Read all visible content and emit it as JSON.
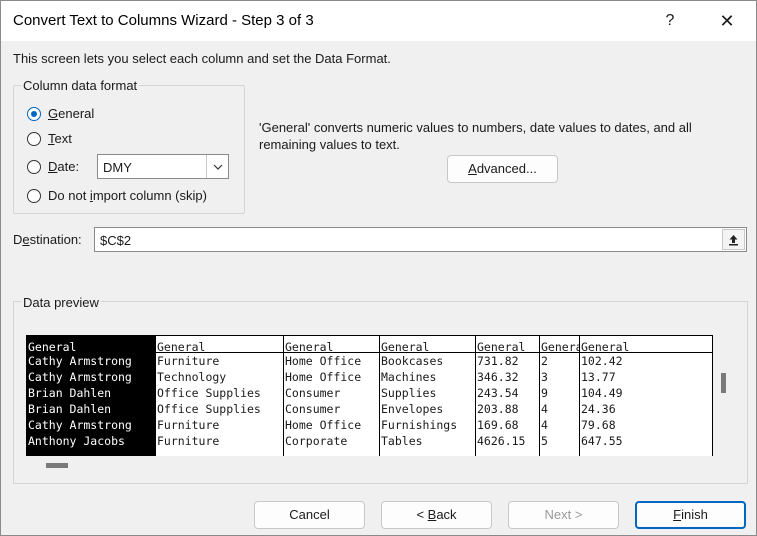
{
  "window": {
    "title": "Convert Text to Columns Wizard - Step 3 of 3",
    "help_glyph": "?",
    "close_glyph": "✕"
  },
  "description": "This screen lets you select each column and set the Data Format.",
  "column_format": {
    "legend": "Column data format",
    "options": [
      {
        "pre": "",
        "key": "G",
        "post": "eneral",
        "checked": true
      },
      {
        "pre": "",
        "key": "T",
        "post": "ext",
        "checked": false
      },
      {
        "pre": "",
        "key": "D",
        "post": "ate:",
        "checked": false
      },
      {
        "pre": "Do not ",
        "key": "i",
        "post": "mport column (skip)",
        "checked": false
      }
    ],
    "date_value": "DMY"
  },
  "info_text": "'General' converts numeric values to numbers, date values to dates, and all remaining values to text.",
  "advanced": {
    "pre": "",
    "key": "A",
    "post": "dvanced..."
  },
  "destination": {
    "label_pre": "D",
    "label_key": "e",
    "label_post": "stination:",
    "value": "$C$2"
  },
  "preview": {
    "legend": "Data preview",
    "columns": [
      {
        "header": "General",
        "selected": true,
        "cells": [
          "Cathy Armstrong",
          "Cathy Armstrong",
          "Brian Dahlen",
          "Brian Dahlen",
          "Cathy Armstrong",
          "Anthony Jacobs"
        ]
      },
      {
        "header": "General",
        "selected": false,
        "cells": [
          "Furniture",
          "Technology",
          "Office Supplies",
          "Office Supplies",
          "Furniture",
          "Furniture"
        ]
      },
      {
        "header": "General",
        "selected": false,
        "cells": [
          "Home Office",
          "Home Office",
          "Consumer",
          "Consumer",
          "Home Office",
          "Corporate"
        ]
      },
      {
        "header": "General",
        "selected": false,
        "cells": [
          "Bookcases",
          "Machines",
          "Supplies",
          "Envelopes",
          "Furnishings",
          "Tables"
        ]
      },
      {
        "header": "General",
        "selected": false,
        "cells": [
          "731.82",
          "346.32",
          "243.54",
          "203.88",
          "169.68",
          "4626.15"
        ]
      },
      {
        "header": "General",
        "selected": false,
        "cells": [
          "2",
          "3",
          "9",
          "4",
          "4",
          "5"
        ]
      },
      {
        "header": "General",
        "selected": false,
        "cells": [
          "102.42",
          "13.77",
          "104.49",
          "24.36",
          "79.68",
          "647.55"
        ]
      }
    ]
  },
  "buttons": {
    "cancel": "Cancel",
    "back": {
      "pre": "< ",
      "key": "B",
      "post": "ack"
    },
    "next": "Next >",
    "finish": {
      "pre": "",
      "key": "F",
      "post": "inish"
    }
  },
  "colors": {
    "accent": "#0067c0",
    "selected_column_bg": "#000000"
  }
}
